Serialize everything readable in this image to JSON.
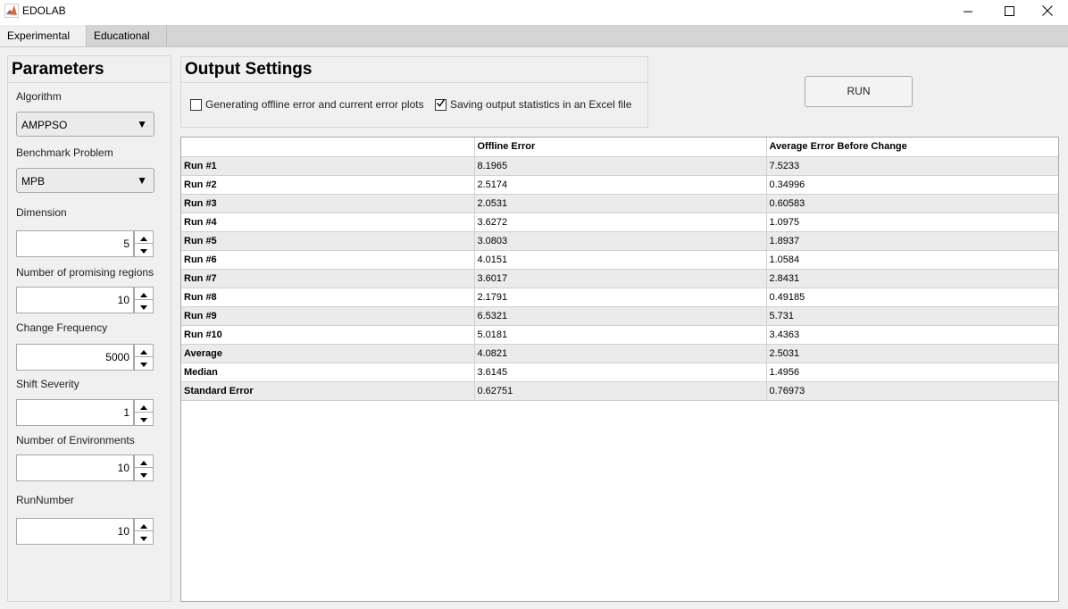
{
  "window": {
    "title": "EDOLAB"
  },
  "tabs": [
    {
      "label": "Experimental",
      "active": true
    },
    {
      "label": "Educational",
      "active": false
    }
  ],
  "parameters": {
    "title": "Parameters",
    "algorithm": {
      "label": "Algorithm",
      "value": "AMPPSO"
    },
    "benchmark": {
      "label": "Benchmark Problem",
      "value": "MPB"
    },
    "dimension": {
      "label": "Dimension",
      "value": "5"
    },
    "regions": {
      "label": "Number of promising regions",
      "value": "10"
    },
    "change_frequency": {
      "label": "Change Frequency",
      "value": "5000"
    },
    "shift_severity": {
      "label": "Shift Severity",
      "value": "1"
    },
    "environments": {
      "label": "Number of Environments",
      "value": "10"
    },
    "run_number": {
      "label": "RunNumber",
      "value": "10"
    }
  },
  "output_settings": {
    "title": "Output Settings",
    "plots_checkbox": {
      "label": "Generating offline error and current error plots",
      "checked": false
    },
    "excel_checkbox": {
      "label": "Saving output statistics in an Excel file",
      "checked": true
    }
  },
  "run_button": {
    "label": "RUN"
  },
  "results": {
    "columns": [
      "",
      "Offline Error",
      "Average Error Before Change"
    ],
    "rows": [
      [
        "Run #1",
        "8.1965",
        "7.5233"
      ],
      [
        "Run #2",
        "2.5174",
        "0.34996"
      ],
      [
        "Run #3",
        "2.0531",
        "0.60583"
      ],
      [
        "Run #4",
        "3.6272",
        "1.0975"
      ],
      [
        "Run #5",
        "3.0803",
        "1.8937"
      ],
      [
        "Run #6",
        "4.0151",
        "1.0584"
      ],
      [
        "Run #7",
        "3.6017",
        "2.8431"
      ],
      [
        "Run #8",
        "2.1791",
        "0.49185"
      ],
      [
        "Run #9",
        "6.5321",
        "5.731"
      ],
      [
        "Run #10",
        "5.0181",
        "3.4363"
      ],
      [
        "Average",
        "4.0821",
        "2.5031"
      ],
      [
        "Median",
        "3.6145",
        "1.4956"
      ],
      [
        "Standard Error",
        "0.62751",
        "0.76973"
      ]
    ]
  },
  "icons": {
    "app": "matlab-logo-icon",
    "minimize": "minimize-icon",
    "maximize": "maximize-icon",
    "close": "close-icon",
    "dropdown": "chevron-down-icon",
    "spin_up": "spin-up-icon",
    "spin_down": "spin-down-icon",
    "check": "checkmark-icon"
  }
}
